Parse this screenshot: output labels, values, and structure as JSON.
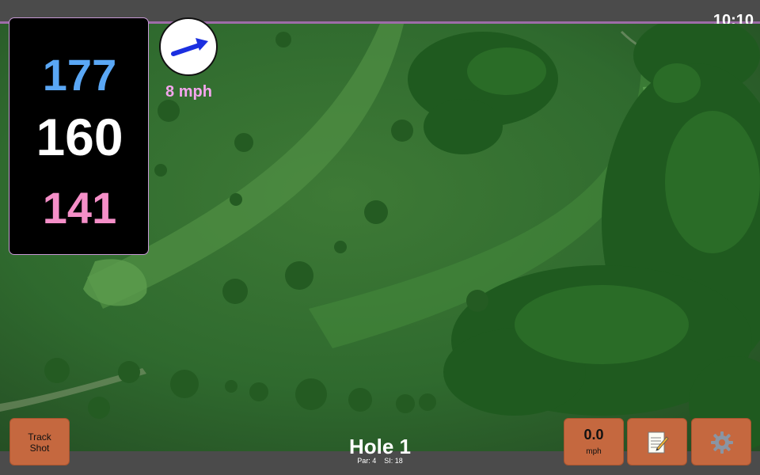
{
  "status_bar": {
    "time": "10:10"
  },
  "distances": {
    "back": "177",
    "middle": "160",
    "front": "141",
    "colors": {
      "back": "#5aa7f5",
      "middle": "#ffffff",
      "front": "#f58fc8"
    }
  },
  "wind": {
    "speed_label": "8 mph",
    "arrow_color": "#1b2fe0",
    "label_color": "#f5a6ee"
  },
  "controls": {
    "track_shot_label": "Track Shot",
    "speed_value": "0.0",
    "speed_unit": "mph",
    "notes_icon": "notepad-icon",
    "settings_icon": "gear-icon",
    "button_color": "#c5683f"
  },
  "hole": {
    "title": "Hole 1",
    "par": "Par: 4",
    "stroke_index": "SI: 18"
  }
}
